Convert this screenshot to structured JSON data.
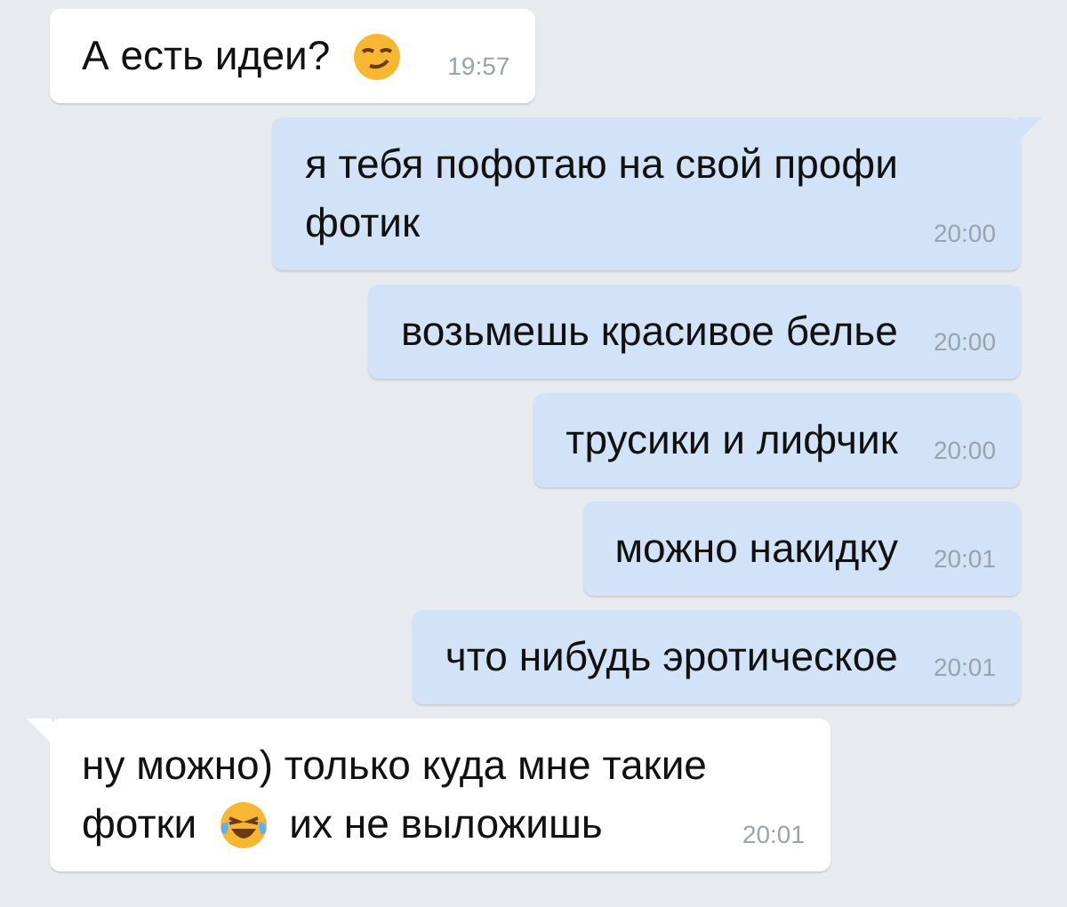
{
  "messages": [
    {
      "kind": "incoming",
      "tail": false,
      "lines": [
        [
          {
            "kind": "text",
            "text": "А есть идеи?"
          },
          {
            "kind": "smirk-emoji"
          }
        ]
      ],
      "time": "19:57"
    },
    {
      "kind": "outgoing",
      "tail": true,
      "lines": [
        [
          {
            "kind": "text",
            "text": "я тебя пофотаю на свой профи"
          }
        ],
        [
          {
            "kind": "text",
            "text": "фотик"
          }
        ]
      ],
      "time": "20:00"
    },
    {
      "kind": "outgoing",
      "tail": false,
      "lines": [
        [
          {
            "kind": "text",
            "text": "возьмешь красивое белье"
          }
        ]
      ],
      "time": "20:00"
    },
    {
      "kind": "outgoing",
      "tail": false,
      "lines": [
        [
          {
            "kind": "text",
            "text": "трусики и лифчик"
          }
        ]
      ],
      "time": "20:00"
    },
    {
      "kind": "outgoing",
      "tail": false,
      "lines": [
        [
          {
            "kind": "text",
            "text": "можно накидку"
          }
        ]
      ],
      "time": "20:01"
    },
    {
      "kind": "outgoing",
      "tail": false,
      "lines": [
        [
          {
            "kind": "text",
            "text": "что нибудь эротическое"
          }
        ]
      ],
      "time": "20:01"
    },
    {
      "kind": "incoming",
      "tail": true,
      "lines": [
        [
          {
            "kind": "text",
            "text": "ну можно) только куда мне такие"
          }
        ],
        [
          {
            "kind": "text",
            "text": "фотки"
          },
          {
            "kind": "laugh-emoji"
          },
          {
            "kind": "text",
            "text": "их не выложишь"
          }
        ]
      ],
      "time": "20:01"
    }
  ]
}
